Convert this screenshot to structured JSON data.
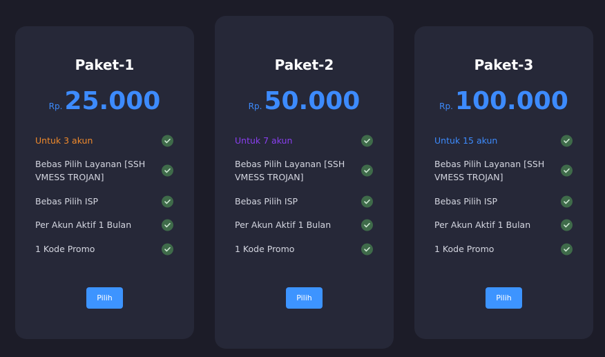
{
  "plans": [
    {
      "title": "Paket-1",
      "currency": "Rp.",
      "price": "25.000",
      "accent": "#f08a2c",
      "features": [
        "Untuk 3 akun",
        "Bebas Pilih Layanan [SSH VMESS TROJAN]",
        "Bebas Pilih ISP",
        "Per Akun Aktif 1 Bulan",
        "1 Kode Promo"
      ],
      "button_label": "Pilih"
    },
    {
      "title": "Paket-2",
      "currency": "Rp.",
      "price": "50.000",
      "accent": "#8a3ff0",
      "features": [
        "Untuk 7 akun",
        "Bebas Pilih Layanan [SSH VMESS TROJAN]",
        "Bebas Pilih ISP",
        "Per Akun Aktif 1 Bulan",
        "1 Kode Promo"
      ],
      "button_label": "Pilih"
    },
    {
      "title": "Paket-3",
      "currency": "Rp.",
      "price": "100.000",
      "accent": "#3d8bfd",
      "features": [
        "Untuk 15 akun",
        "Bebas Pilih Layanan [SSH VMESS TROJAN]",
        "Bebas Pilih ISP",
        "Per Akun Aktif 1 Bulan",
        "1 Kode Promo"
      ],
      "button_label": "Pilih"
    }
  ],
  "colors": {
    "page_bg": "#1c1c28",
    "card_bg": "#262838",
    "price": "#3d8bfd",
    "button": "#3d94ff",
    "check_bg": "#3f6b4a"
  },
  "icons": {
    "feature_check": "check-circle-icon"
  }
}
